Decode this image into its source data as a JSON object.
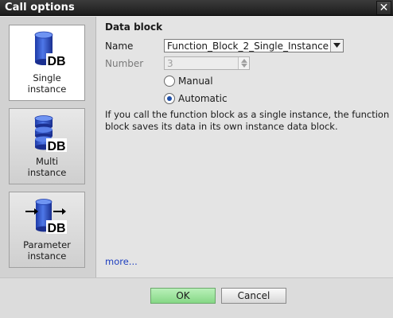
{
  "window": {
    "title": "Call options",
    "close_glyph": "✕"
  },
  "sidebar": {
    "tiles": [
      {
        "line1": "Single",
        "line2": "instance",
        "icon": "db-single-instance-icon",
        "selected": true
      },
      {
        "line1": "Multi",
        "line2": "instance",
        "icon": "db-multi-instance-icon",
        "selected": false
      },
      {
        "line1": "Parameter",
        "line2": "instance",
        "icon": "db-parameter-instance-icon",
        "selected": false
      }
    ],
    "icon_text": "DB"
  },
  "data_block": {
    "section_title": "Data block",
    "name_label": "Name",
    "name_value": "Function_Block_2_Single_Instance",
    "number_label": "Number",
    "number_value": "3",
    "number_mode_options": [
      {
        "label": "Manual",
        "checked": false
      },
      {
        "label": "Automatic",
        "checked": true
      }
    ]
  },
  "description": {
    "line1": "If you call the function block as a single instance, the function",
    "line2": "block saves its data in its own instance data block."
  },
  "more_link": "more...",
  "buttons": {
    "ok": "OK",
    "cancel": "Cancel"
  },
  "colors": {
    "db_cylinder": "#3a5fd0",
    "ok_button": "#9fe59f",
    "link": "#1f3fbf"
  }
}
